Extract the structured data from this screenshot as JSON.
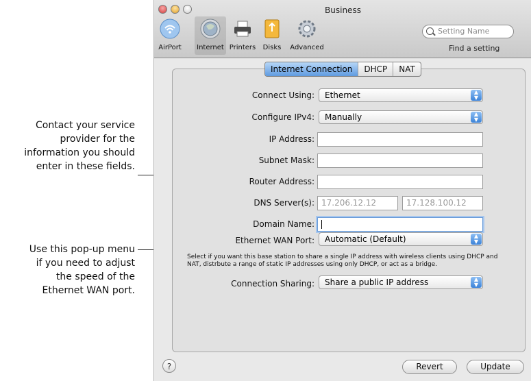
{
  "annotations": {
    "fields_note": [
      "Contact your service",
      "provider for the",
      "information you should",
      "enter in these fields."
    ],
    "popup_note": [
      "Use this pop-up menu",
      "if you need to adjust",
      "the speed of the",
      "Ethernet WAN port."
    ]
  },
  "window": {
    "title": "Business",
    "toolbar": [
      {
        "label": "AirPort",
        "icon": "airport-icon"
      },
      {
        "label": "Internet",
        "icon": "internet-icon",
        "selected": true
      },
      {
        "label": "Printers",
        "icon": "printer-icon"
      },
      {
        "label": "Disks",
        "icon": "disk-icon"
      },
      {
        "label": "Advanced",
        "icon": "gear-icon"
      }
    ],
    "search_placeholder": "Setting Name",
    "search_caption": "Find a setting"
  },
  "tabs": [
    "Internet Connection",
    "DHCP",
    "NAT"
  ],
  "form": {
    "connect_using_label": "Connect Using:",
    "connect_using_value": "Ethernet",
    "configure_ipv4_label": "Configure IPv4:",
    "configure_ipv4_value": "Manually",
    "ip_address_label": "IP Address:",
    "ip_address_value": "",
    "subnet_mask_label": "Subnet Mask:",
    "subnet_mask_value": "",
    "router_address_label": "Router Address:",
    "router_address_value": "",
    "dns_label": "DNS Server(s):",
    "dns1_placeholder": "17.206.12.12",
    "dns2_placeholder": "17.128.100.12",
    "domain_name_label": "Domain Name:",
    "domain_name_value": "",
    "wan_port_label": "Ethernet WAN Port:",
    "wan_port_value": "Automatic (Default)",
    "help_text_1": "Select if you want this base station to share a single IP address with wireless clients using DHCP and",
    "help_text_2": "NAT, distrbute a range of static IP addresses using only DHCP, or act as a bridge.",
    "sharing_label": "Connection Sharing:",
    "sharing_value": "Share a public IP address"
  },
  "buttons": {
    "help": "?",
    "revert": "Revert",
    "update": "Update"
  },
  "colors": {
    "accent": "#5f9be0",
    "window_bg": "#e9e9e9"
  }
}
